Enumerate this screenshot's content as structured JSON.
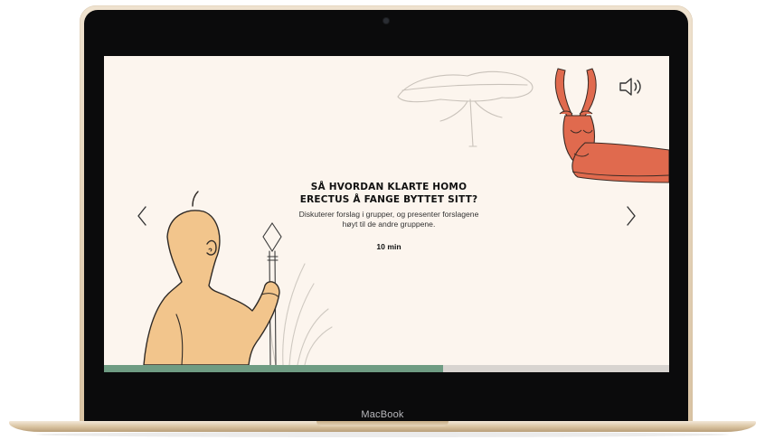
{
  "device": {
    "brand_label": "MacBook"
  },
  "slide": {
    "title_line1": "SÅ HVORDAN KLARTE HOMO",
    "title_line2": "ERECTUS Å FANGE BYTTET SITT?",
    "description_line1": "Diskuterer forslag i grupper, og presenter forslagene",
    "description_line2": "høyt til de andre gruppene.",
    "duration": "10 min"
  },
  "controls": {
    "prev_icon": "chevron-left-icon",
    "next_icon": "chevron-right-icon",
    "sound_icon": "speaker-icon"
  },
  "progress": {
    "fraction": 0.6
  },
  "colors": {
    "background": "#fcf5ee",
    "progress_fill": "#6f9c83",
    "progress_track": "#d8d4d0",
    "figure_skin": "#f2c58c",
    "antelope": "#e06a4e"
  }
}
